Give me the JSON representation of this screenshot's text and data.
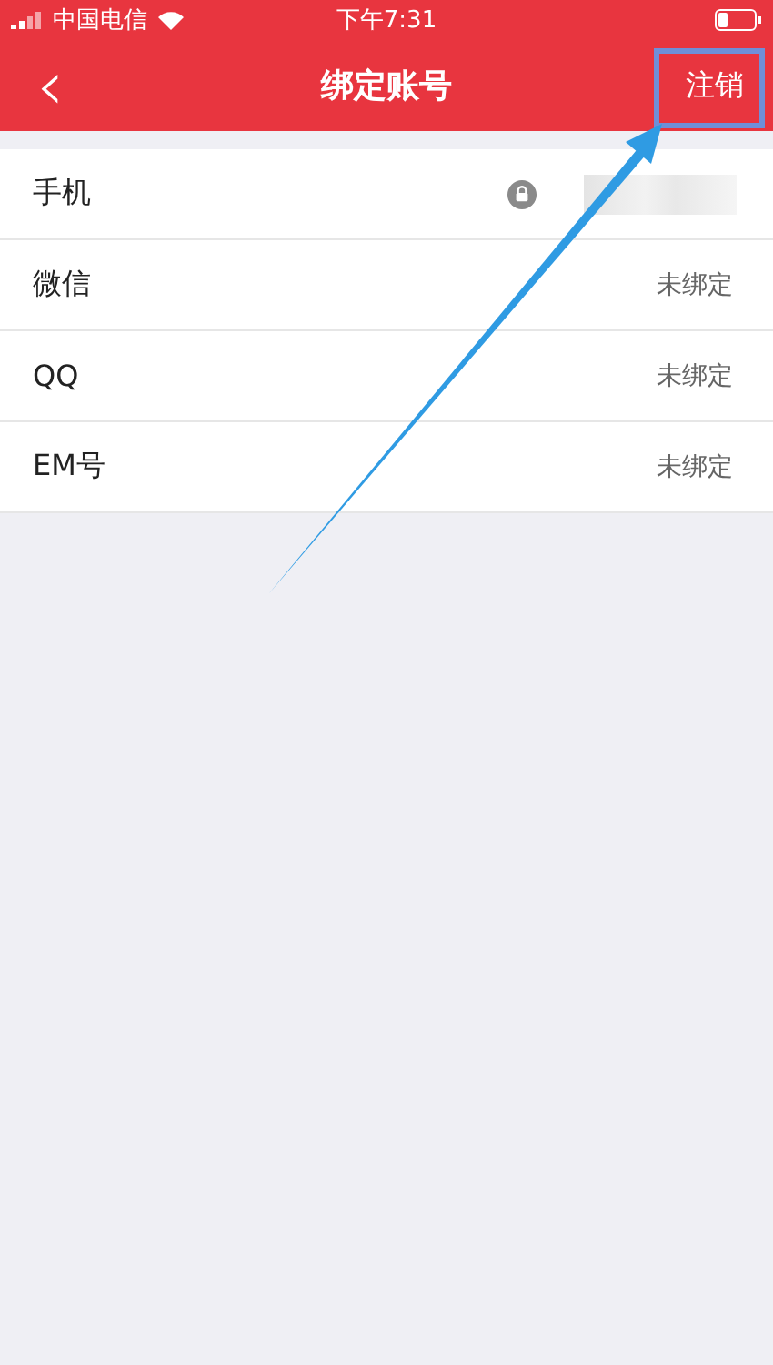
{
  "status_bar": {
    "carrier": "中国电信",
    "time": "下午7:31"
  },
  "nav_bar": {
    "back": "‹",
    "title": "绑定账号",
    "action": "注销"
  },
  "accounts": [
    {
      "kind": "locked",
      "label": "手机"
    },
    {
      "kind": "status",
      "label": "微信",
      "status": "未绑定"
    },
    {
      "kind": "status",
      "label": "QQ",
      "status": "未绑定"
    },
    {
      "kind": "status",
      "label": "EM号",
      "status": "未绑定"
    }
  ]
}
